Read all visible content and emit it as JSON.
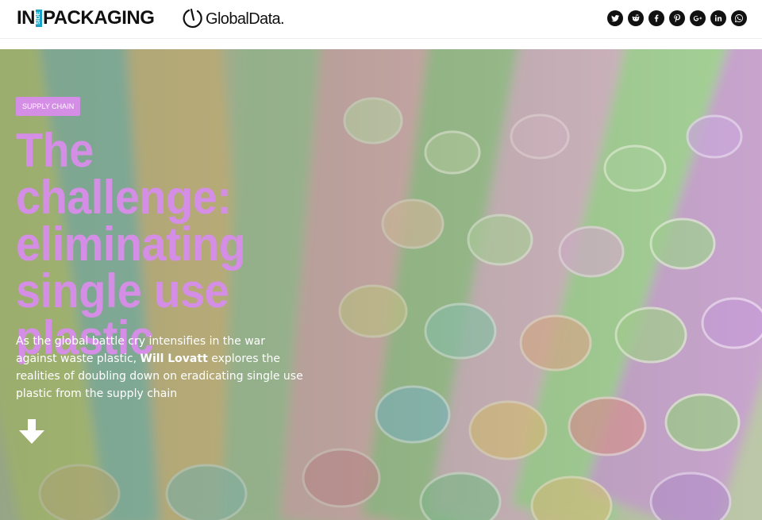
{
  "header": {
    "logo": {
      "prefix": "IN",
      "side": "SIDE",
      "main": "PACKAGING"
    },
    "partner_logo": "GlobalData.",
    "social": [
      {
        "name": "twitter-icon",
        "glyph": "t"
      },
      {
        "name": "reddit-icon",
        "glyph": "r"
      },
      {
        "name": "facebook-icon",
        "glyph": "f"
      },
      {
        "name": "pinterest-icon",
        "glyph": "p"
      },
      {
        "name": "google-plus-icon",
        "glyph": "G+"
      },
      {
        "name": "linkedin-icon",
        "glyph": "in"
      },
      {
        "name": "whatsapp-icon",
        "glyph": "w"
      }
    ]
  },
  "hero": {
    "tag": "SUPPLY CHAIN",
    "headline": "The challenge: eliminating single use plastic",
    "standfirst": {
      "before": "As the global battle cry intensifies in the war against waste plastic, ",
      "author": "Will Lovatt",
      "after": " explores the realities of doubling down on eradicating single use plastic from the supply chain"
    },
    "scroll_icon": "arrow-down-icon"
  },
  "colors": {
    "accent": "#d58ee6",
    "logo_side": "#18a2c6",
    "social_bg": "#111111"
  }
}
